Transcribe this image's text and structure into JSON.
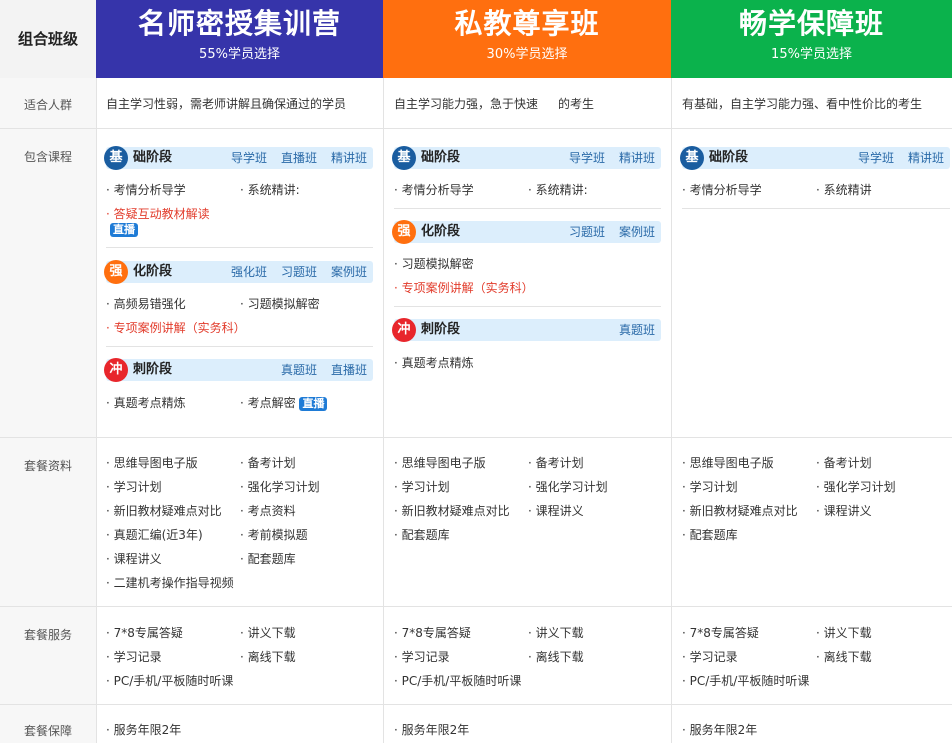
{
  "corner": "组合班级",
  "row_labels": [
    "适合人群",
    "包含课程",
    "套餐资料",
    "套餐服务",
    "套餐保障"
  ],
  "colors": {
    "plan1": "#3634aa",
    "plan2": "#ff6f0f",
    "plan3": "#0bb24c",
    "jichu": "#1a5da0",
    "qianghua": "#ff6f0f",
    "chongci": "#e8262c"
  },
  "plans": [
    {
      "title": "名师密授集训营",
      "subtitle": "55%学员选择",
      "fit": "自主学习性弱，需老师讲解且确保通过的学员",
      "phases": [
        {
          "badge": "基",
          "name": "础阶段",
          "tags": [
            "导学班",
            "直播班",
            "精讲班"
          ],
          "items": [
            "· 考情分析导学",
            "· 系统精讲:",
            "· 答疑互动教材解读"
          ],
          "live": "直播"
        },
        {
          "badge": "强",
          "name": "化阶段",
          "tags": [
            "强化班",
            "习题班",
            "案例班"
          ],
          "items": [
            "· 高频易错强化",
            "· 习题模拟解密",
            "· 专项案例讲解（实务科）"
          ]
        },
        {
          "badge": "冲",
          "name": "刺阶段",
          "tags": [
            "真题班",
            "直播班"
          ],
          "items": [
            "· 真题考点精炼",
            "· 考点解密"
          ],
          "live": "直播"
        }
      ],
      "materials": [
        "· 思维导图电子版",
        "· 备考计划",
        "· 学习计划",
        "· 强化学习计划",
        "· 新旧教材疑难点对比",
        "· 考点资料",
        "· 真题汇编(近3年)",
        "· 考前模拟题",
        "· 课程讲义",
        "· 配套题库",
        "· 二建机考操作指导视频"
      ],
      "services": [
        "· 7*8专属答疑",
        "· 讲义下载",
        "· 学习记录",
        "· 离线下载",
        "· PC/手机/平板随时听课"
      ],
      "guarantee": "· 服务年限2年"
    },
    {
      "title": "私教尊享班",
      "subtitle": "30%学员选择",
      "fit": "自主学习能力强，急于快速",
      "fit2": "的考生",
      "phases": [
        {
          "badge": "基",
          "name": "础阶段",
          "tags": [
            "导学班",
            "精讲班"
          ],
          "items": [
            "· 考情分析导学",
            "· 系统精讲:"
          ]
        },
        {
          "badge": "强",
          "name": "化阶段",
          "tags": [
            "习题班",
            "案例班"
          ],
          "items": [
            "· 习题模拟解密",
            "· 专项案例讲解（实务科）"
          ]
        },
        {
          "badge": "冲",
          "name": "刺阶段",
          "tags": [
            "真题班"
          ],
          "items": [
            "· 真题考点精炼"
          ]
        }
      ],
      "materials": [
        "· 思维导图电子版",
        "· 备考计划",
        "· 学习计划",
        "· 强化学习计划",
        "· 新旧教材疑难点对比",
        "· 课程讲义",
        "· 配套题库"
      ],
      "services": [
        "· 7*8专属答疑",
        "· 讲义下载",
        "· 学习记录",
        "· 离线下载",
        "· PC/手机/平板随时听课"
      ],
      "guarantee": "· 服务年限2年"
    },
    {
      "title": "畅学保障班",
      "subtitle": "15%学员选择",
      "fit": "有基础，自主学习能力强、看中性价比的考生",
      "phases": [
        {
          "badge": "基",
          "name": "础阶段",
          "tags": [
            "导学班",
            "精讲班"
          ],
          "items": [
            "· 考情分析导学",
            "· 系统精讲"
          ]
        }
      ],
      "materials": [
        "· 思维导图电子版",
        "· 备考计划",
        "· 学习计划",
        "· 强化学习计划",
        "· 新旧教材疑难点对比",
        "· 课程讲义",
        "· 配套题库"
      ],
      "services": [
        "· 7*8专属答疑",
        "· 讲义下载",
        "· 学习记录",
        "· 离线下载",
        "· PC/手机/平板随时听课"
      ],
      "guarantee": "· 服务年限2年"
    }
  ]
}
